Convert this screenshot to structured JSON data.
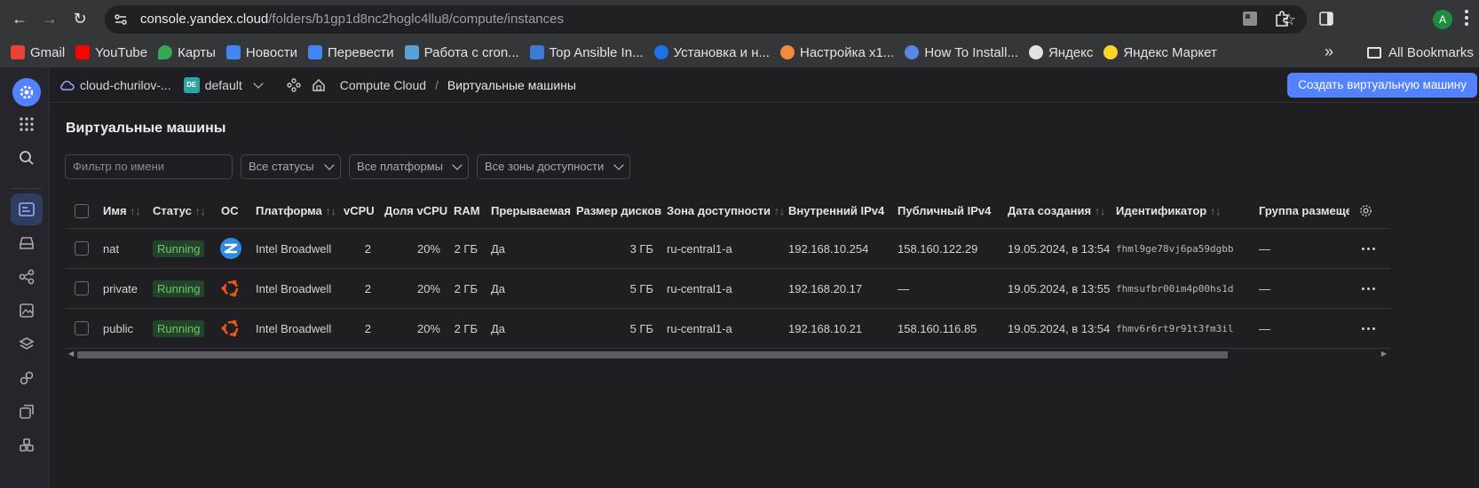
{
  "browser": {
    "url_host": "console.yandex.cloud",
    "url_path": "/folders/b1gp1d8nc2hoglc4llu8/compute/instances",
    "profile_initial": "A",
    "bookmarks": [
      {
        "label": "Gmail",
        "color": "#ea4335"
      },
      {
        "label": "YouTube",
        "color": "#ff0000"
      },
      {
        "label": "Карты",
        "color": "#34a853"
      },
      {
        "label": "Новости",
        "color": "#4285f4"
      },
      {
        "label": "Перевести",
        "color": "#4285f4"
      },
      {
        "label": "Работа с cron...",
        "color": "#5aa0d8"
      },
      {
        "label": "Top Ansible In...",
        "color": "#3a7bd5"
      },
      {
        "label": "Установка и н...",
        "color": "#1a73e8"
      },
      {
        "label": "Настройка x1...",
        "color": "#f28b3c"
      },
      {
        "label": "How To Install...",
        "color": "#5b86e5"
      },
      {
        "label": "Яндекс",
        "color": "#e3e3e3"
      },
      {
        "label": "Яндекс Маркет",
        "color": "#fed42b"
      }
    ],
    "all_bookmarks": "All Bookmarks"
  },
  "header": {
    "cloud": "cloud-churilov-...",
    "folder_badge": "DE",
    "folder": "default",
    "breadcrumb_service": "Compute Cloud",
    "breadcrumb_sep": "/",
    "breadcrumb_current": "Виртуальные машины",
    "create_button": "Создать виртуальную машину"
  },
  "page": {
    "title": "Виртуальные машины",
    "filter_placeholder": "Фильтр по имени",
    "status_select": "Все статусы",
    "platform_select": "Все платформы",
    "zone_select": "Все зоны доступности"
  },
  "table": {
    "headers": [
      "Имя",
      "Статус",
      "ОС",
      "Платформа",
      "vCPU",
      "Доля vCPU",
      "RAM",
      "Прерываемая",
      "Размер дисков",
      "Зона доступности",
      "Внутренний IPv4",
      "Публичный IPv4",
      "Дата создания",
      "Идентификатор",
      "Группа размещен"
    ],
    "rows": [
      {
        "name": "nat",
        "status": "Running",
        "os": "nat-icon",
        "platform": "Intel Broadwell",
        "vcpu": "2",
        "share": "20%",
        "ram": "2 ГБ",
        "preemptible": "Да",
        "disk": "3 ГБ",
        "zone": "ru-central1-a",
        "internal_ip": "192.168.10.254",
        "public_ip": "158.160.122.29",
        "created": "19.05.2024, в 13:54",
        "id": "fhml9ge78vj6pa59dgbb",
        "group": "—"
      },
      {
        "name": "private",
        "status": "Running",
        "os": "ubuntu-icon",
        "platform": "Intel Broadwell",
        "vcpu": "2",
        "share": "20%",
        "ram": "2 ГБ",
        "preemptible": "Да",
        "disk": "5 ГБ",
        "zone": "ru-central1-a",
        "internal_ip": "192.168.20.17",
        "public_ip": "—",
        "created": "19.05.2024, в 13:55",
        "id": "fhmsufbr00im4p00hs1d",
        "group": "—"
      },
      {
        "name": "public",
        "status": "Running",
        "os": "ubuntu-icon",
        "platform": "Intel Broadwell",
        "vcpu": "2",
        "share": "20%",
        "ram": "2 ГБ",
        "preemptible": "Да",
        "disk": "5 ГБ",
        "zone": "ru-central1-a",
        "internal_ip": "192.168.10.21",
        "public_ip": "158.160.116.85",
        "created": "19.05.2024, в 13:54",
        "id": "fhmv6r6rt9r91t3fm3il",
        "group": "—"
      }
    ]
  },
  "colors": {
    "accent": "#5282ff",
    "status_running": "#6cc06c"
  }
}
